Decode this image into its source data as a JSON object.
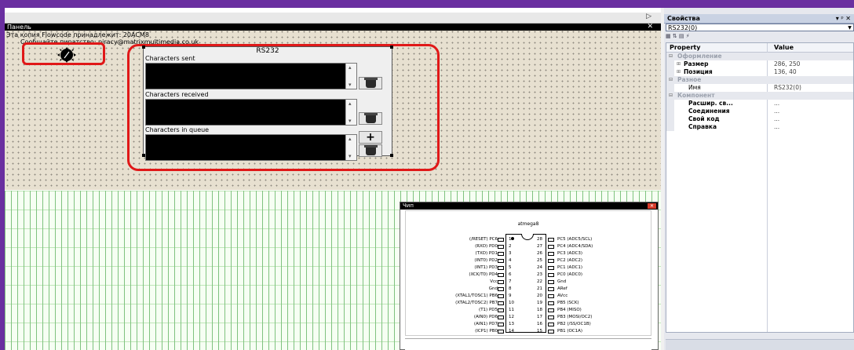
{
  "panel": {
    "title": "Панель",
    "close": "✕",
    "ownership": "Эта копия Flowcode принадлежит: 20ACM8",
    "piracy": "Сообщайте пиратство: piracy@matrixmultimedia.co.uk"
  },
  "tabstrip": {
    "arrow": "▷"
  },
  "rs232": {
    "title": "RS232",
    "sent_label": "Characters sent",
    "received_label": "Characters received",
    "queue_label": "Characters in queue",
    "add_label": "+"
  },
  "chip": {
    "title": "Чип",
    "close": "✕",
    "name": "atmega8",
    "left_pins": [
      {
        "name": "(/RESET) PC6",
        "num": "1"
      },
      {
        "name": "(RXD) PD0",
        "num": "2"
      },
      {
        "name": "(TXD) PD1",
        "num": "3"
      },
      {
        "name": "(INT0) PD2",
        "num": "4"
      },
      {
        "name": "(INT1) PD3",
        "num": "5"
      },
      {
        "name": "(XCK/T0) PD4",
        "num": "6"
      },
      {
        "name": "Vcc",
        "num": "7"
      },
      {
        "name": "Gnd",
        "num": "8"
      },
      {
        "name": "(XTAL1/TOSC1) PB6",
        "num": "9"
      },
      {
        "name": "(XTAL2/TOSC2) PB7",
        "num": "10"
      },
      {
        "name": "(T1) PD5",
        "num": "11"
      },
      {
        "name": "(AIN0) PD6",
        "num": "12"
      },
      {
        "name": "(AIN1) PD7",
        "num": "13"
      },
      {
        "name": "(ICP1) PB0",
        "num": "14"
      }
    ],
    "right_pins": [
      {
        "name": "PC5 (ADC5/SCL)",
        "num": "28"
      },
      {
        "name": "PC4 (ADC4/SDA)",
        "num": "27"
      },
      {
        "name": "PC3 (ADC3)",
        "num": "26"
      },
      {
        "name": "PC2 (ADC2)",
        "num": "25"
      },
      {
        "name": "PC1 (ADC1)",
        "num": "24"
      },
      {
        "name": "PC0 (ADC0)",
        "num": "23"
      },
      {
        "name": "Gnd",
        "num": "22"
      },
      {
        "name": "ARef",
        "num": "21"
      },
      {
        "name": "AVcc",
        "num": "20"
      },
      {
        "name": "PB5 (SCK)",
        "num": "19"
      },
      {
        "name": "PB4 (MISO)",
        "num": "18"
      },
      {
        "name": "PB3 (MOSI/OC2)",
        "num": "17"
      },
      {
        "name": "PB2 (/SS/OC1B)",
        "num": "16"
      },
      {
        "name": "PB1 (OC1A)",
        "num": "15"
      }
    ]
  },
  "properties": {
    "title": "Свойства",
    "controls": "▾ ᵖ ✕",
    "selected_object": "RS232(0)",
    "toolbar": "▦ ⇅ ▤ ⚡",
    "col_property": "Property",
    "col_value": "Value",
    "rows": [
      {
        "kind": "cat",
        "name": "Оформление",
        "value": ""
      },
      {
        "kind": "sub",
        "name": "Размер",
        "value": "286, 250"
      },
      {
        "kind": "sub",
        "name": "Позиция",
        "value": "136, 40"
      },
      {
        "kind": "cat",
        "name": "Разное",
        "value": ""
      },
      {
        "kind": "plain",
        "name": "Имя",
        "value": "RS232(0)"
      },
      {
        "kind": "cat",
        "name": "Компонент",
        "value": ""
      },
      {
        "kind": "bold",
        "name": "Расшир. св...",
        "value": "..."
      },
      {
        "kind": "bold",
        "name": "Соединения",
        "value": "..."
      },
      {
        "kind": "bold",
        "name": "Свой код",
        "value": "..."
      },
      {
        "kind": "bold",
        "name": "Справка",
        "value": "..."
      }
    ]
  }
}
